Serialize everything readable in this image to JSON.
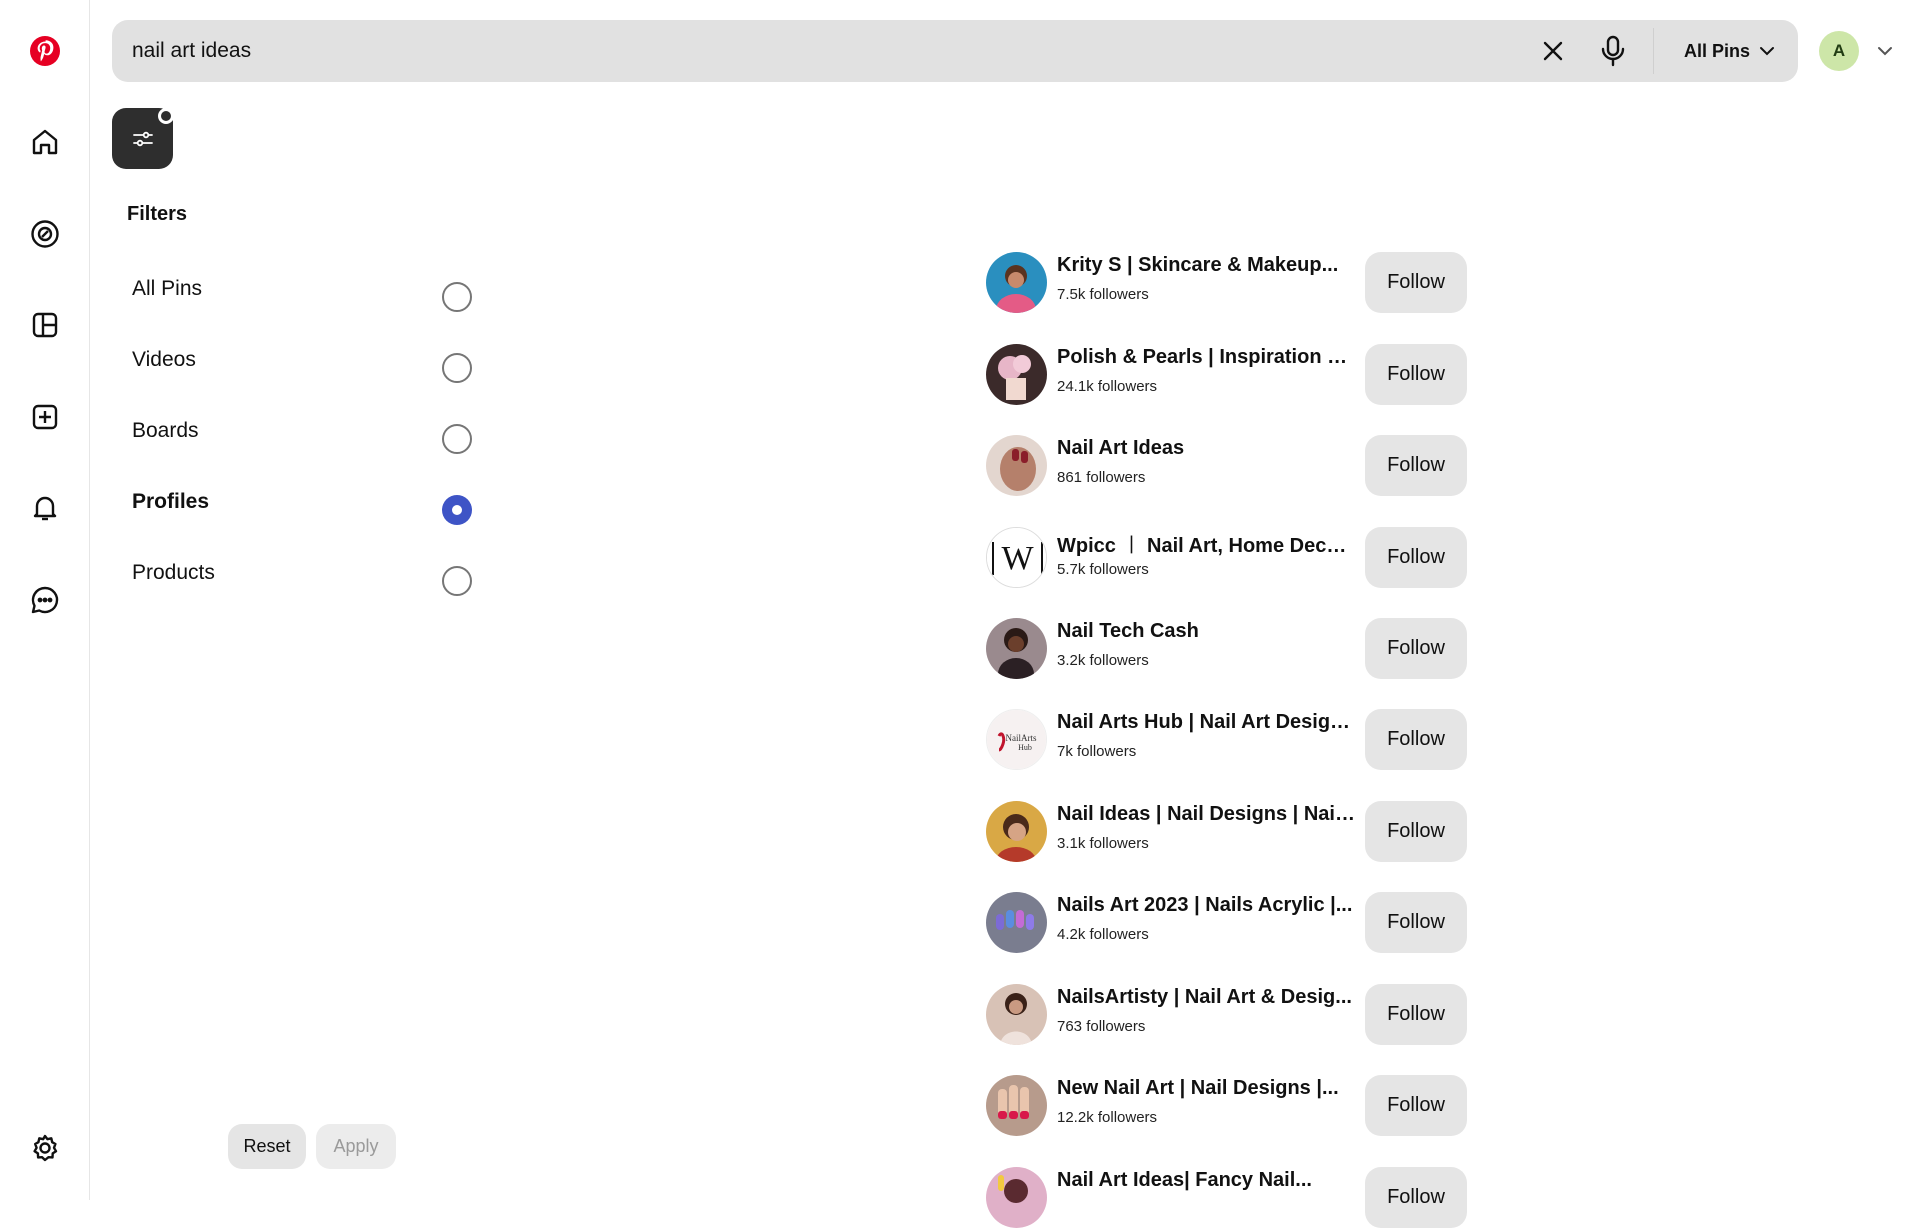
{
  "search": {
    "query": "nail art ideas",
    "scope_label": "All Pins"
  },
  "account": {
    "avatar_initial": "A"
  },
  "filters": {
    "title": "Filters",
    "options": [
      {
        "label": "All Pins",
        "selected": false
      },
      {
        "label": "Videos",
        "selected": false
      },
      {
        "label": "Boards",
        "selected": false
      },
      {
        "label": "Profiles",
        "selected": true
      },
      {
        "label": "Products",
        "selected": false
      }
    ],
    "reset_label": "Reset",
    "apply_label": "Apply"
  },
  "profiles": [
    {
      "name": "Krity S | Skincare & Makeup...",
      "followers": "7.5k followers",
      "follow_label": "Follow"
    },
    {
      "name": "Polish & Pearls | Inspiration an...",
      "followers": "24.1k followers",
      "follow_label": "Follow"
    },
    {
      "name": "Nail Art Ideas",
      "followers": "861 followers",
      "follow_label": "Follow"
    },
    {
      "name": "Wpicc ︱ Nail Art, Home Decor...",
      "followers": "5.7k followers",
      "follow_label": "Follow"
    },
    {
      "name": "Nail Tech Cash",
      "followers": "3.2k followers",
      "follow_label": "Follow"
    },
    {
      "name": "Nail Arts Hub | Nail Art Design...",
      "followers": "7k followers",
      "follow_label": "Follow"
    },
    {
      "name": "Nail Ideas | Nail Designs | Nail...",
      "followers": "3.1k followers",
      "follow_label": "Follow"
    },
    {
      "name": "Nails Art 2023 | Nails Acrylic |...",
      "followers": "4.2k followers",
      "follow_label": "Follow"
    },
    {
      "name": "NailsArtisty | Nail Art & Desig...",
      "followers": "763 followers",
      "follow_label": "Follow"
    },
    {
      "name": "New Nail Art | Nail Designs |...",
      "followers": "12.2k followers",
      "follow_label": "Follow"
    },
    {
      "name": "Nail Art Ideas| Fancy Nail...",
      "followers": "",
      "follow_label": "Follow"
    }
  ],
  "colors": {
    "brand": "#e60023",
    "selected_radio": "#3e54c6",
    "search_bg": "#e1e1e1",
    "button_bg": "#e5e5e5"
  },
  "icons": {
    "rail": [
      "pinterest-logo",
      "home-icon",
      "explore-icon",
      "create-board-icon",
      "create-pin-icon",
      "notifications-icon",
      "messages-icon",
      "settings-icon"
    ]
  }
}
